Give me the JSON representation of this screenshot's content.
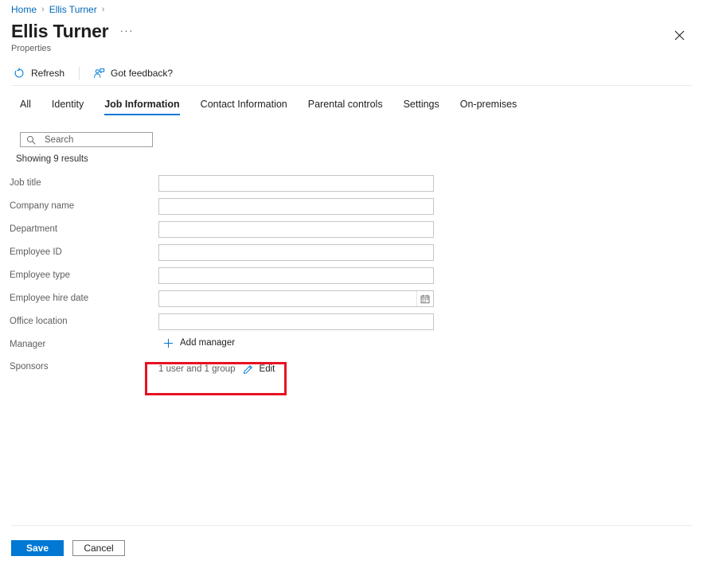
{
  "breadcrumb": {
    "items": [
      {
        "label": "Home"
      },
      {
        "label": "Ellis Turner"
      }
    ],
    "separator": "›"
  },
  "header": {
    "title": "Ellis Turner",
    "ellipsis": "···",
    "subtitle": "Properties",
    "close_icon": "close-icon"
  },
  "commandbar": {
    "refresh_label": "Refresh",
    "refresh_icon": "refresh-icon",
    "feedback_label": "Got feedback?",
    "feedback_icon": "feedback-person-icon"
  },
  "tabs": [
    {
      "label": "All",
      "active": false
    },
    {
      "label": "Identity",
      "active": false
    },
    {
      "label": "Job Information",
      "active": true
    },
    {
      "label": "Contact Information",
      "active": false
    },
    {
      "label": "Parental controls",
      "active": false
    },
    {
      "label": "Settings",
      "active": false
    },
    {
      "label": "On-premises",
      "active": false
    }
  ],
  "search": {
    "placeholder": "Search",
    "value": "",
    "icon": "search-icon"
  },
  "results": {
    "text": "Showing 9 results"
  },
  "form": {
    "fields": [
      {
        "label": "Job title",
        "value": "",
        "type": "text"
      },
      {
        "label": "Company name",
        "value": "",
        "type": "text"
      },
      {
        "label": "Department",
        "value": "",
        "type": "text"
      },
      {
        "label": "Employee ID",
        "value": "",
        "type": "text"
      },
      {
        "label": "Employee type",
        "value": "",
        "type": "text"
      },
      {
        "label": "Employee hire date",
        "value": "",
        "type": "date"
      },
      {
        "label": "Office location",
        "value": "",
        "type": "text"
      }
    ],
    "manager": {
      "label": "Manager",
      "action_label": "Add manager",
      "action_icon": "plus-icon"
    },
    "sponsors": {
      "label": "Sponsors",
      "value": "1 user and 1 group",
      "edit_label": "Edit",
      "edit_icon": "pencil-icon"
    }
  },
  "annotation": {
    "color": "#e81123",
    "target": "sponsors-value"
  },
  "footer": {
    "save_label": "Save",
    "cancel_label": "Cancel"
  },
  "colors": {
    "accent": "#0078d4",
    "link": "#0067b8",
    "text": "#201f1e",
    "muted": "#605e5c",
    "border": "#c8c6c4",
    "highlight": "#e81123"
  }
}
